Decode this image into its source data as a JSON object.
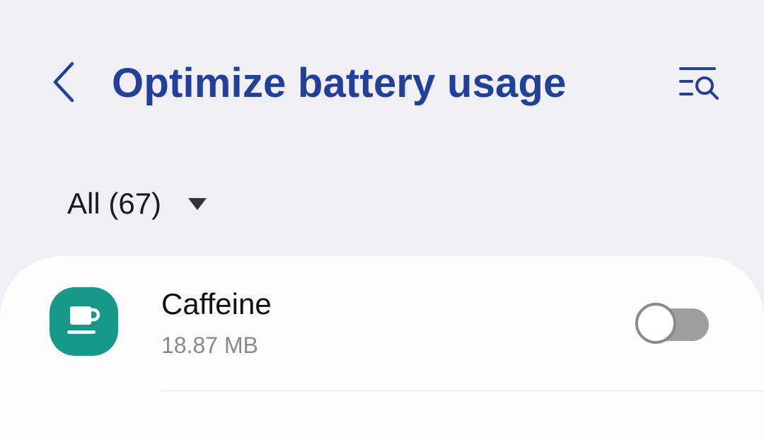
{
  "header": {
    "title": "Optimize battery usage",
    "back_icon": "chevron-left-icon",
    "search_icon": "filter-search-icon",
    "title_color": "#22409a"
  },
  "filter": {
    "label": "All (67)",
    "icon": "caret-down-icon"
  },
  "apps": [
    {
      "name": "Caffeine",
      "size": "18.87 MB",
      "icon": "coffee-cup-icon",
      "icon_color": "#17998a",
      "optimized": false
    }
  ]
}
